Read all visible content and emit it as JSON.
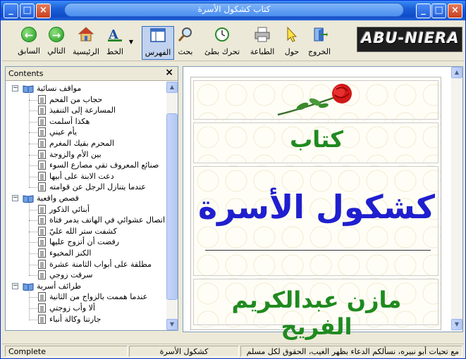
{
  "window": {
    "title": "كتاب كشكول الأسرة"
  },
  "toolbar": {
    "back": "السابق",
    "next": "التالي",
    "home": "الرئيسية",
    "font": "الخط",
    "index": "الفهرس",
    "search": "بحث",
    "slow_move": "تحرك بطئ",
    "print": "الطباعة",
    "about": "حول",
    "exit": "الخروج",
    "logo": "ABU-NIERA"
  },
  "contents": {
    "title": "Contents",
    "close": "×",
    "groups": [
      {
        "label": "مواقف نسائية",
        "items": [
          "حجاب من الفحم",
          "المسارعة إلى التنفيذ",
          "هكذا أسلمت",
          "يأم عيني",
          "المحرم بقيك المغرم",
          "بين الأم والزوجة",
          "صنائع المعروف تقي مصارع السوء",
          "دعت الابنة على أبيها",
          "عندما يتنازل الرجل عن قوامته"
        ]
      },
      {
        "label": "قصص واقعية",
        "items": [
          "أبنائي الذكور",
          "اتصال عشوائي في الهاتف يدمر فتاة",
          "كشفت ستر الله عليّ",
          "رفضت أن أتزوج عليها",
          "الكنز المخبوء",
          "مطلقة على أبواب الثامنة عشرة",
          "سرقت زوجي"
        ]
      },
      {
        "label": "طرائف أسرية",
        "items": [
          "عندما هممت بالزواج من الثانية",
          "ألا وأب زوجتي",
          "جارتنا وكالة أنباء"
        ]
      }
    ]
  },
  "page": {
    "kitab": "كتاب",
    "title": "كشكول الأسرة",
    "author": "مازن عبدالكريم الفريح"
  },
  "statusbar": {
    "status": "Complete",
    "book": "كشكول الأسرة",
    "message": "مع تحيات أبو نبيره، نسألكم الدعاء بظهر الغيب، الحقوق لكل مسلم"
  }
}
